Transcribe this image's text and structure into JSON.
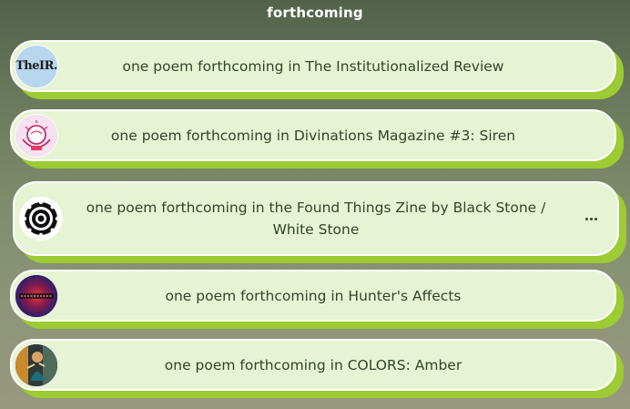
{
  "section": {
    "title": "forthcoming"
  },
  "links": [
    {
      "label": "one poem forthcoming in The Institutionalized Review",
      "thumb_text": "TheIR.",
      "thumb_icon": "the-institutionalized-review-logo"
    },
    {
      "label": "one poem forthcoming in Divinations Magazine #3: Siren",
      "thumb_icon": "crystal-ball-hands-icon"
    },
    {
      "label": "one poem forthcoming in the Found Things Zine by Black Stone / White Stone",
      "thumb_icon": "concentric-ring-logo",
      "menu_icon": "more-options-icon"
    },
    {
      "label": "one poem forthcoming in Hunter's Affects",
      "thumb_icon": "hunters-affects-logo"
    },
    {
      "label": "one poem forthcoming in COLORS: Amber",
      "thumb_icon": "colors-amber-cover-image"
    }
  ],
  "colors": {
    "card_background": "#e6f4d3",
    "card_shadow": "#9ccb33",
    "card_border": "#ffffff",
    "text": "#34432a",
    "title": "#ffffff"
  }
}
